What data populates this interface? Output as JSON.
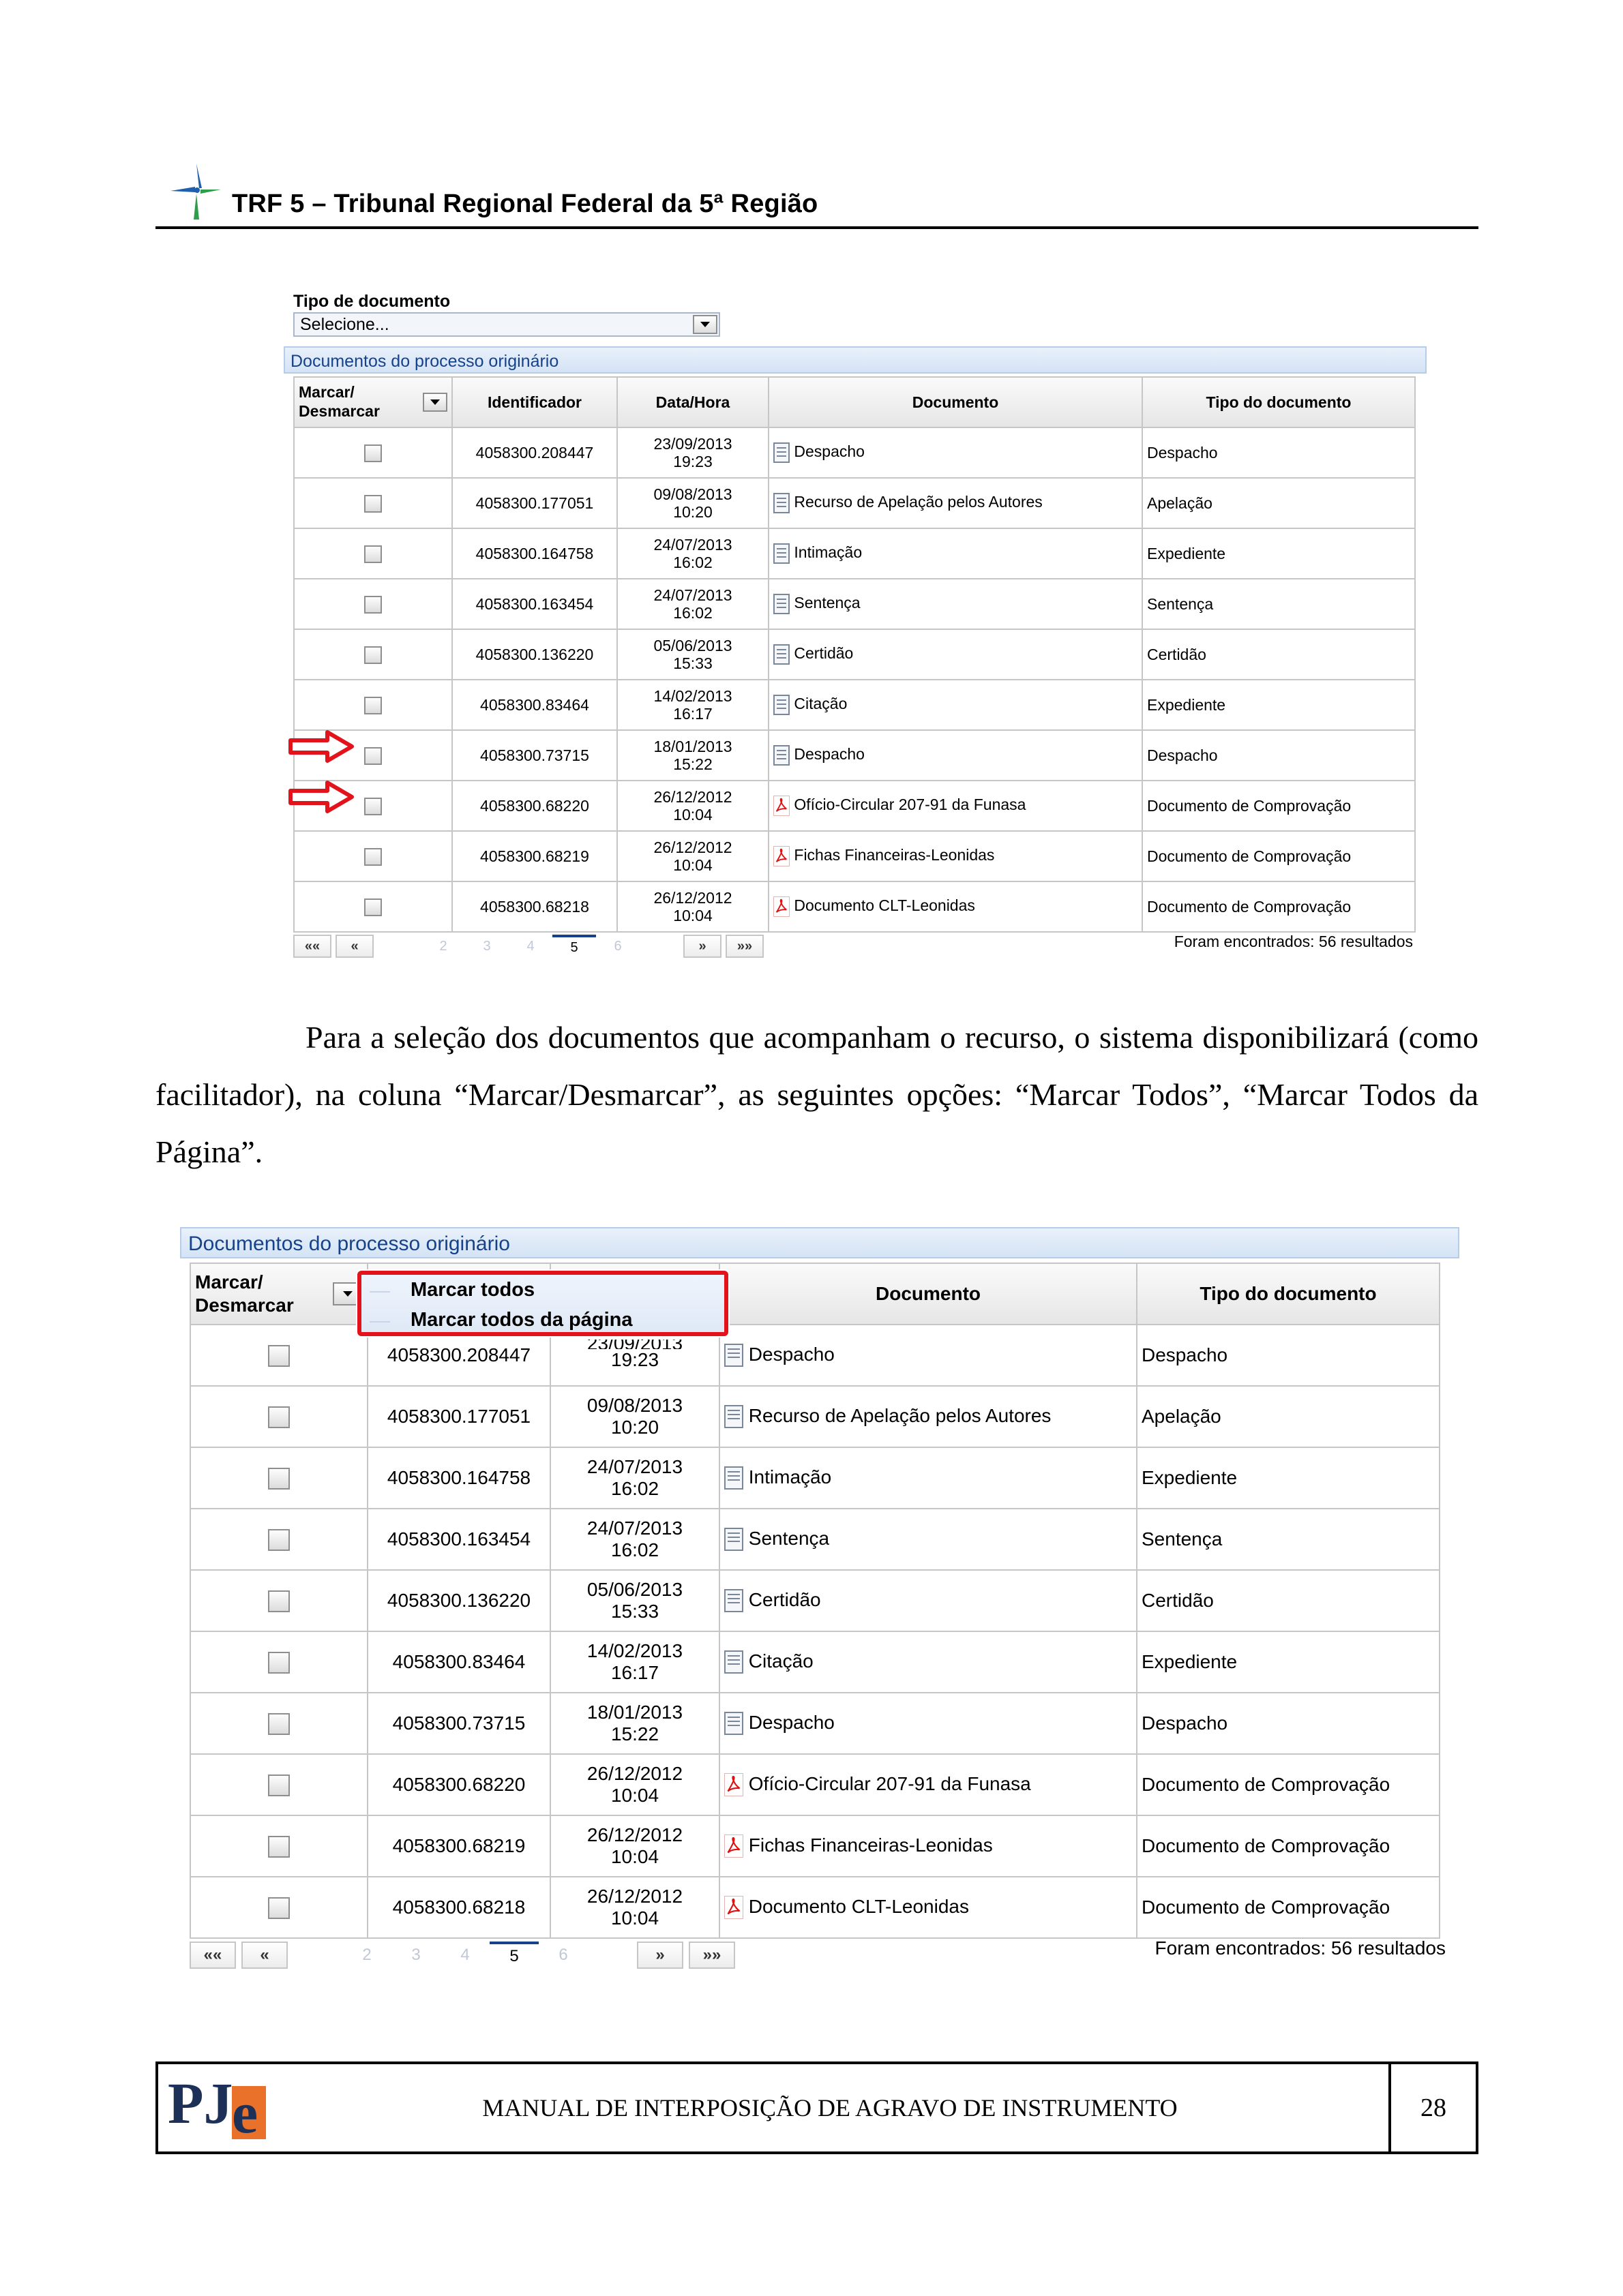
{
  "header": {
    "title": "TRF 5 – Tribunal Regional Federal da 5ª Região"
  },
  "screenshot1": {
    "tipo_label": "Tipo de documento",
    "tipo_value": "Selecione...",
    "panel_title": "Documentos do processo originário",
    "found_text": "Foram encontrados: 56 resultados"
  },
  "table": {
    "headers": {
      "select_line1": "Marcar/",
      "select_line2": "Desmarcar",
      "id": "Identificador",
      "datetime": "Data/Hora",
      "document": "Documento",
      "type": "Tipo do documento"
    },
    "rows": [
      {
        "id": "4058300.208447",
        "date": "23/09/2013",
        "time": "19:23",
        "doc": "Despacho",
        "type": "Despacho",
        "icon": "document-icon"
      },
      {
        "id": "4058300.177051",
        "date": "09/08/2013",
        "time": "10:20",
        "doc": "Recurso de Apelação pelos Autores",
        "type": "Apelação",
        "icon": "document-icon"
      },
      {
        "id": "4058300.164758",
        "date": "24/07/2013",
        "time": "16:02",
        "doc": "Intimação",
        "type": "Expediente",
        "icon": "document-icon"
      },
      {
        "id": "4058300.163454",
        "date": "24/07/2013",
        "time": "16:02",
        "doc": "Sentença",
        "type": "Sentença",
        "icon": "document-icon"
      },
      {
        "id": "4058300.136220",
        "date": "05/06/2013",
        "time": "15:33",
        "doc": "Certidão",
        "type": "Certidão",
        "icon": "document-icon"
      },
      {
        "id": "4058300.83464",
        "date": "14/02/2013",
        "time": "16:17",
        "doc": "Citação",
        "type": "Expediente",
        "icon": "document-icon"
      },
      {
        "id": "4058300.73715",
        "date": "18/01/2013",
        "time": "15:22",
        "doc": "Despacho",
        "type": "Despacho",
        "icon": "document-icon"
      },
      {
        "id": "4058300.68220",
        "date": "26/12/2012",
        "time": "10:04",
        "doc": "Ofício-Circular 207-91 da Funasa",
        "type": "Documento de Comprovação",
        "icon": "pdf-icon"
      },
      {
        "id": "4058300.68219",
        "date": "26/12/2012",
        "time": "10:04",
        "doc": "Fichas Financeiras-Leonidas",
        "type": "Documento de Comprovação",
        "icon": "pdf-icon"
      },
      {
        "id": "4058300.68218",
        "date": "26/12/2012",
        "time": "10:04",
        "doc": "Documento CLT-Leonidas",
        "type": "Documento de Comprovação",
        "icon": "pdf-icon"
      }
    ],
    "arrow_rows": [
      6,
      7
    ]
  },
  "pager": {
    "first": "««",
    "prev": "«",
    "next": "»",
    "last": "»»",
    "pages": [
      "2",
      "3",
      "4",
      "5",
      "6"
    ],
    "current": "5"
  },
  "paragraph": "Para a seleção dos documentos que acompanham o recurso, o sistema disponibilizará (como facilitador), na coluna “Marcar/Desmarcar”, as seguintes opções: “Marcar Todos”, “Marcar Todos da Página”.",
  "screenshot2": {
    "panel_title": "Documentos do processo originário",
    "menu_items": [
      "Marcar todos",
      "Marcar todos da página"
    ],
    "row1_partial_date": "23/09/2013",
    "found_text": "Foram encontrados: 56 resultados"
  },
  "footer": {
    "logo_text_pj": "PJ",
    "logo_text_e": "e",
    "manual_title": "MANUAL DE INTERPOSIÇÃO DE AGRAVO DE INSTRUMENTO",
    "page_number": "28"
  },
  "colors": {
    "highlight_red": "#e3131b",
    "panel_blue": "#15428b",
    "logo_orange": "#e9712a",
    "logo_navy": "#1d3158"
  }
}
